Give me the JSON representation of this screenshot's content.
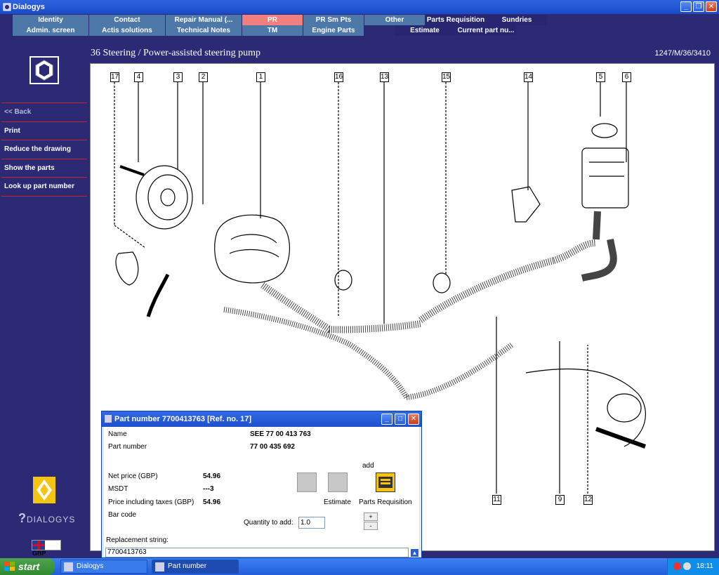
{
  "window": {
    "title": "Dialogys"
  },
  "menu": {
    "row1": [
      {
        "label": "Identity",
        "style": "normal"
      },
      {
        "label": "Contact",
        "style": "normal"
      },
      {
        "label": "Repair Manual (...",
        "style": "normal"
      },
      {
        "label": "PR",
        "style": "pr"
      },
      {
        "label": "PR Sm Pts",
        "style": "normal"
      },
      {
        "label": "Other",
        "style": "normal"
      },
      {
        "label": "Parts Requisition",
        "style": "dark"
      },
      {
        "label": "Sundries",
        "style": "dark"
      }
    ],
    "row2": [
      {
        "label": "Admin. screen",
        "style": "normal"
      },
      {
        "label": "Actis solutions",
        "style": "normal"
      },
      {
        "label": "Technical Notes",
        "style": "normal"
      },
      {
        "label": "TM",
        "style": "normal"
      },
      {
        "label": "Engine Parts",
        "style": "normal"
      },
      {
        "label": "Estimate",
        "style": "dark"
      },
      {
        "label": "Current part nu...",
        "style": "dark"
      }
    ]
  },
  "sidebar": {
    "items": [
      {
        "label": "<< Back",
        "kind": "back"
      },
      {
        "label": "Print",
        "kind": "normal"
      },
      {
        "label": "Reduce the drawing",
        "kind": "normal"
      },
      {
        "label": "Show the parts",
        "kind": "normal"
      },
      {
        "label": "Look up part number",
        "kind": "normal"
      }
    ],
    "brand": "DIALOGYS",
    "currency": "GBP"
  },
  "header": {
    "title": "36 Steering / Power-assisted steering pump",
    "ref": "1247/M/36/3410"
  },
  "drawing": {
    "callouts": [
      "17",
      "4",
      "3",
      "2",
      "1",
      "16",
      "13",
      "15",
      "14",
      "5",
      "6",
      "11",
      "9",
      "12"
    ]
  },
  "dialog": {
    "title": "Part number 7700413763 [Ref. no. 17]",
    "name_label": "Name",
    "name_value": "SEE 77 00 413 763",
    "partno_label": "Part number",
    "partno_value": "77 00 435 692",
    "net_label": "Net price (GBP)",
    "net_value": "54.96",
    "msdt_label": "MSDT",
    "msdt_value": "---3",
    "incl_label": "Price including taxes (GBP)",
    "incl_value": "54.96",
    "barcode_label": "Bar code",
    "add_label": "add",
    "estimate_label": "Estimate",
    "requisition_label": "Parts Requisition",
    "qty_label": "Quantity to add:",
    "qty_value": "1.0",
    "plus": "+",
    "minus": "-",
    "repl_label": "Replacement string:",
    "repl_value": "7700413763"
  },
  "taskbar": {
    "start": "start",
    "tasks": [
      {
        "label": "Dialogys",
        "active": false
      },
      {
        "label": "Part number 7700413...",
        "active": true
      }
    ],
    "clock": "18:11"
  }
}
